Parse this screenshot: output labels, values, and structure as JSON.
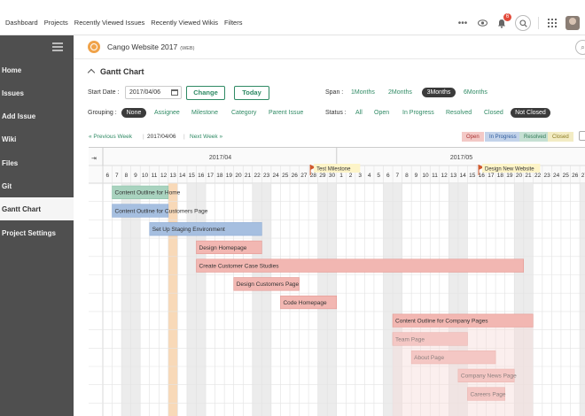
{
  "topnav": {
    "items": [
      "Dashboard",
      "Projects",
      "Recently Viewed Issues",
      "Recently Viewed Wikis",
      "Filters"
    ],
    "notification_count": "6"
  },
  "sidebar": {
    "items": [
      {
        "label": "Home",
        "active": false
      },
      {
        "label": "Issues",
        "active": false
      },
      {
        "label": "Add Issue",
        "active": false
      },
      {
        "label": "Wiki",
        "active": false
      },
      {
        "label": "Files",
        "active": false
      },
      {
        "label": "Git",
        "active": false
      },
      {
        "label": "Gantt Chart",
        "active": true
      },
      {
        "label": "Project Settings",
        "active": false
      }
    ]
  },
  "project": {
    "name": "Cango Website 2017",
    "key": "(WEB)"
  },
  "page_title": "Gantt Chart",
  "controls": {
    "start_date_label": "Start Date :",
    "start_date_value": "2017/04/06",
    "change_label": "Change",
    "today_label": "Today",
    "span_label": "Span :",
    "span_options": [
      "1Months",
      "2Months",
      "3Months",
      "6Months"
    ],
    "span_selected": "3Months",
    "grouping_label": "Grouping :",
    "grouping_options": [
      "None",
      "Assignee",
      "Milestone",
      "Category",
      "Parent Issue"
    ],
    "grouping_selected": "None",
    "status_label": "Status :",
    "status_options": [
      "All",
      "Open",
      "In Progress",
      "Resolved",
      "Closed",
      "Not Closed"
    ],
    "status_selected": "Not Closed",
    "prev_week": "« Previous Week",
    "current_date": "2017/04/06",
    "next_week": "Next Week »"
  },
  "legend": [
    {
      "label": "Open",
      "color": "#f3c9c6"
    },
    {
      "label": "In Progress",
      "color": "#c3d3ea"
    },
    {
      "label": "Resolved",
      "color": "#c6e0d3"
    },
    {
      "label": "Closed",
      "color": "#f3ecc4"
    }
  ],
  "gantt": {
    "months": [
      "2017/04",
      "2017/05"
    ],
    "days": [
      6,
      7,
      8,
      9,
      10,
      11,
      12,
      13,
      14,
      15,
      16,
      17,
      18,
      19,
      20,
      21,
      22,
      23,
      24,
      25,
      26,
      27,
      28,
      29,
      30,
      1,
      2,
      3,
      4,
      5,
      6,
      7,
      8,
      9,
      10,
      11,
      12,
      13,
      14,
      15,
      16,
      17,
      18,
      19,
      20,
      21,
      22,
      23,
      24,
      25,
      26,
      27
    ],
    "weekend_days": [
      "2017-04-08",
      "2017-04-09",
      "2017-04-15",
      "2017-04-16",
      "2017-04-22",
      "2017-04-23",
      "2017-04-29",
      "2017-04-30",
      "2017-05-06",
      "2017-05-07",
      "2017-05-13",
      "2017-05-14",
      "2017-05-20",
      "2017-05-21",
      "2017-05-27"
    ],
    "today": "2017-04-13",
    "milestones": [
      {
        "label": "Test Milestone",
        "date": "2017-04-28"
      },
      {
        "label": "Design New Website",
        "date": "2017-05-16"
      }
    ],
    "tasks": [
      {
        "name": "Content Outline for Home",
        "start": "2017-04-07",
        "end": "2017-04-12",
        "status": "Resolved"
      },
      {
        "name": "Content Outline for Customers Page",
        "start": "2017-04-07",
        "end": "2017-04-12",
        "status": "In Progress"
      },
      {
        "name": "Set Up Staging Environment",
        "start": "2017-04-11",
        "end": "2017-04-22",
        "status": "In Progress"
      },
      {
        "name": "Design Homepage",
        "start": "2017-04-16",
        "end": "2017-04-22",
        "status": "Open"
      },
      {
        "name": "Create Customer Case Studies",
        "start": "2017-04-16",
        "end": "2017-05-20",
        "status": "Open"
      },
      {
        "name": "Design Customers Page",
        "start": "2017-04-20",
        "end": "2017-04-26",
        "status": "Open"
      },
      {
        "name": "Code Homepage",
        "start": "2017-04-25",
        "end": "2017-04-30",
        "status": "Open"
      },
      {
        "name": "Content Outline for Company Pages",
        "start": "2017-05-07",
        "end": "2017-05-21",
        "status": "Open"
      },
      {
        "name": "Team Page",
        "start": "2017-05-07",
        "end": "2017-05-14",
        "status": "Open"
      },
      {
        "name": "About Page",
        "start": "2017-05-09",
        "end": "2017-05-17",
        "status": "Open"
      },
      {
        "name": "Company News Page",
        "start": "2017-05-14",
        "end": "2017-05-19",
        "status": "Open"
      },
      {
        "name": "Careers Page",
        "start": "2017-05-15",
        "end": "2017-05-18",
        "status": "Open"
      }
    ]
  }
}
